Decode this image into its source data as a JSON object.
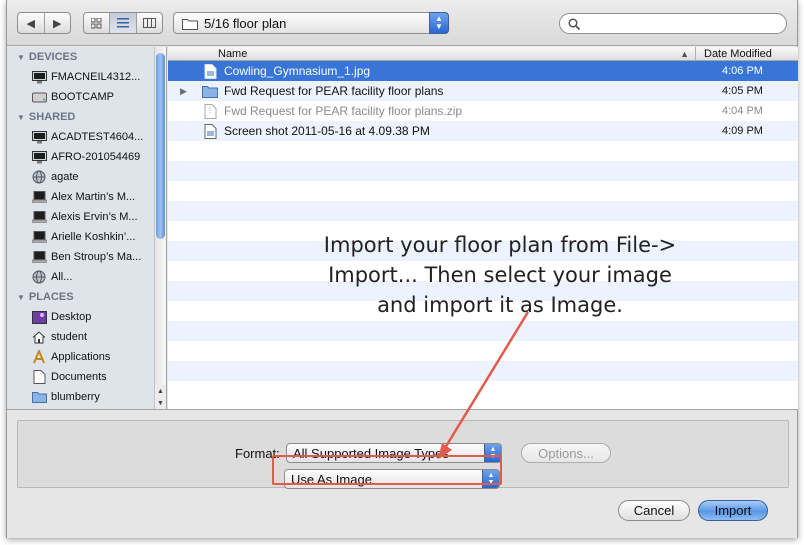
{
  "toolbar": {
    "nav_back": "◀",
    "nav_forward": "▶",
    "path_label": "5/16 floor plan",
    "search_placeholder": ""
  },
  "sidebar": {
    "sections": [
      {
        "header": "DEVICES",
        "items": [
          {
            "label": "FMACNEIL4312...",
            "icon": "computer-icon"
          },
          {
            "label": "BOOTCAMP",
            "icon": "disk-icon"
          }
        ]
      },
      {
        "header": "SHARED",
        "items": [
          {
            "label": "ACADTEST4604...",
            "icon": "computer-icon"
          },
          {
            "label": "AFRO-201054469",
            "icon": "computer-icon"
          },
          {
            "label": "agate",
            "icon": "network-icon"
          },
          {
            "label": "Alex Martin’s M...",
            "icon": "laptop-icon"
          },
          {
            "label": "Alexis Ervin’s M...",
            "icon": "laptop-icon"
          },
          {
            "label": "Arielle Koshkin’...",
            "icon": "laptop-icon"
          },
          {
            "label": "Ben Stroup’s Ma...",
            "icon": "laptop-icon"
          },
          {
            "label": "All...",
            "icon": "network-icon"
          }
        ]
      },
      {
        "header": "PLACES",
        "items": [
          {
            "label": "Desktop",
            "icon": "desktop-icon"
          },
          {
            "label": "student",
            "icon": "home-icon"
          },
          {
            "label": "Applications",
            "icon": "applications-icon"
          },
          {
            "label": "Documents",
            "icon": "documents-icon"
          },
          {
            "label": "blumberry",
            "icon": "folder-icon"
          }
        ]
      }
    ]
  },
  "filelist": {
    "col_name": "Name",
    "col_date": "Date Modified",
    "rows": [
      {
        "name": "Cowling_Gymnasium_1.jpg",
        "date": "4:06 PM",
        "type": "image",
        "selected": true,
        "dim": false
      },
      {
        "name": "Fwd Request for PEAR facility floor plans",
        "date": "4:05 PM",
        "type": "folder",
        "selected": false,
        "dim": false
      },
      {
        "name": "Fwd Request for PEAR facility floor plans.zip",
        "date": "4:04 PM",
        "type": "zip",
        "selected": false,
        "dim": true
      },
      {
        "name": "Screen shot 2011-05-16 at 4.09.38 PM",
        "date": "4:09 PM",
        "type": "image",
        "selected": false,
        "dim": false
      }
    ]
  },
  "options": {
    "format_label": "Format:",
    "format_value": "All Supported Image Types",
    "options_button": "Options...",
    "use_as_value": "Use As Image"
  },
  "buttons": {
    "cancel": "Cancel",
    "import": "Import"
  },
  "annotation": {
    "text": "Import your floor plan from File-> Import... Then select your image and import it as Image."
  },
  "colors": {
    "selection": "#3875d7",
    "accent_blue": "#2a66d1",
    "highlight_red": "#e45a4a"
  }
}
